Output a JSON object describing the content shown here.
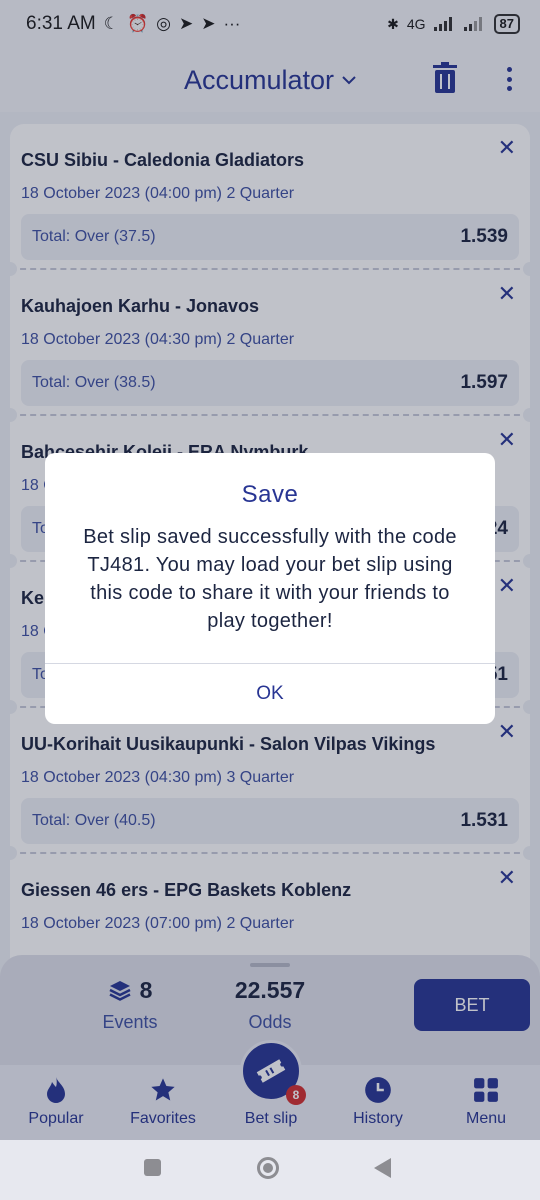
{
  "status_bar": {
    "time": "6:31 AM",
    "network": "4G",
    "battery": "87"
  },
  "header": {
    "title": "Accumulator"
  },
  "bets": [
    {
      "teams": "CSU Sibiu - Caledonia Gladiators",
      "date": "18 October 2023 (04:00 pm) 2 Quarter",
      "market": "Total: Over (37.5)",
      "odd": "1.539"
    },
    {
      "teams": "Kauhajoen Karhu - Jonavos",
      "date": "18 October 2023 (04:30 pm) 2 Quarter",
      "market": "Total: Over (38.5)",
      "odd": "1.597"
    },
    {
      "teams": "Bahcesehir Koleji - ERA Nymburk",
      "date": "18 October 2023",
      "market": "Total",
      "odd": "24"
    },
    {
      "teams": "Ker",
      "date": "18 O",
      "market": "Tot",
      "odd": "51"
    },
    {
      "teams": "UU-Korihait Uusikaupunki - Salon Vilpas Vikings",
      "date": "18 October 2023 (04:30 pm) 3 Quarter",
      "market": "Total: Over (40.5)",
      "odd": "1.531"
    },
    {
      "teams": "Giessen 46 ers - EPG Baskets Koblenz",
      "date": "18 October 2023 (07:00 pm) 2 Quarter",
      "market": "",
      "odd": ""
    }
  ],
  "summary": {
    "events_count": "8",
    "events_label": "Events",
    "odds_value": "22.557",
    "odds_label": "Odds",
    "bet_label": "BET"
  },
  "nav": [
    {
      "label": "Popular",
      "icon": "flame-icon"
    },
    {
      "label": "Favorites",
      "icon": "star-icon"
    },
    {
      "label": "Bet slip",
      "icon": "ticket-icon",
      "badge": "8"
    },
    {
      "label": "History",
      "icon": "clock-icon"
    },
    {
      "label": "Menu",
      "icon": "grid-icon"
    }
  ],
  "dialog": {
    "title": "Save",
    "message": "Bet slip saved successfully with the code TJ481. You may load your bet slip using this code to share it with your friends to play together!",
    "ok_label": "OK"
  },
  "colors": {
    "primary": "#283593",
    "badge": "#d32f2f"
  }
}
